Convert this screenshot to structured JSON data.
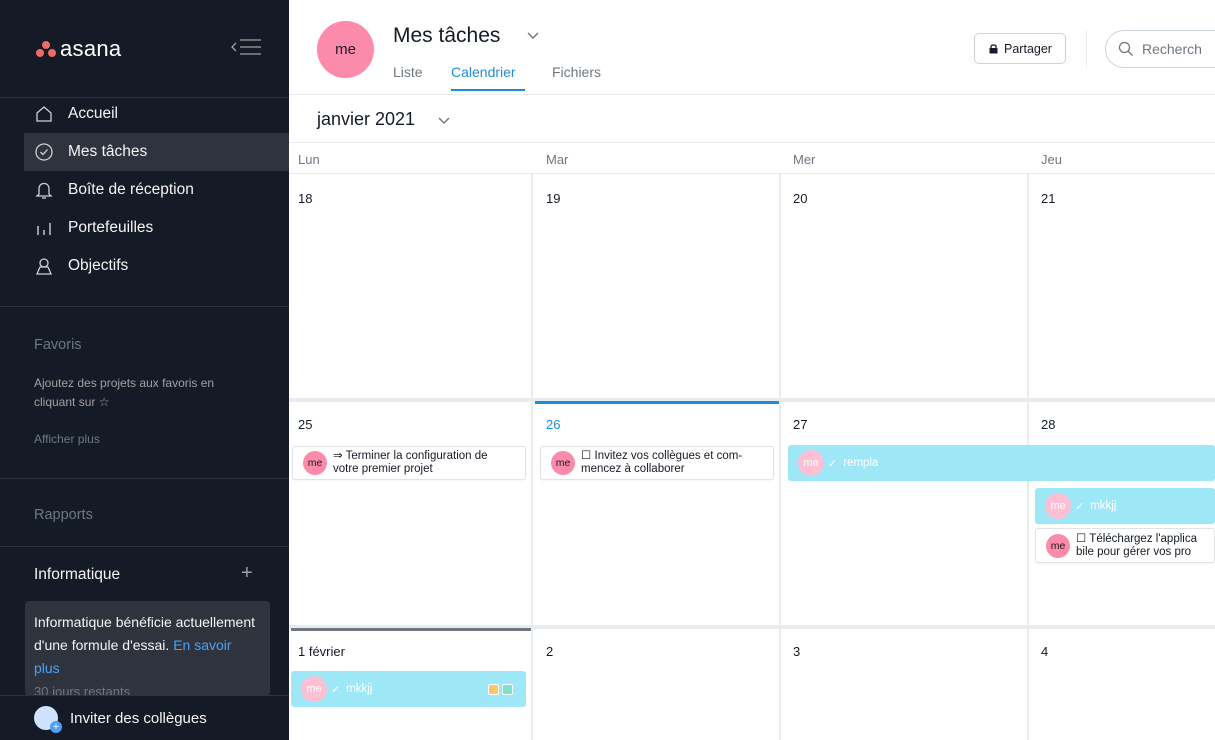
{
  "sidebar": {
    "logo_text": "asana",
    "nav": [
      {
        "label": "Accueil",
        "icon": "home-icon"
      },
      {
        "label": "Mes tâches",
        "icon": "check-circle-icon",
        "active": true
      },
      {
        "label": "Boîte de réception",
        "icon": "bell-icon"
      },
      {
        "label": "Portefeuilles",
        "icon": "bar-chart-icon"
      },
      {
        "label": "Objectifs",
        "icon": "person-icon"
      }
    ],
    "favorites_title": "Favoris",
    "favorites_hint": "Ajoutez des projets aux favoris en cliquant sur ☆",
    "show_more": "Afficher plus",
    "reports": "Rapports",
    "team_name": "Informatique",
    "team_add": "+",
    "trial_text": "Informatique bénéficie actuellement d'une formule d'essai.",
    "trial_link": "En savoir plus",
    "trial_days": "30 jours restants",
    "invite_label": "Inviter des collègues"
  },
  "header": {
    "avatar": "me",
    "title": "Mes tâches",
    "tabs": [
      "Liste",
      "Calendrier",
      "Fichiers"
    ],
    "active_tab": "Calendrier",
    "share_label": "Partager",
    "search_placeholder": "Recherch"
  },
  "calendar": {
    "month_label": "janvier 2021",
    "weekdays": [
      "Lun",
      "Mar",
      "Mer",
      "Jeu"
    ],
    "weeks": [
      [
        "18",
        "19",
        "20",
        "21"
      ],
      [
        "25",
        "26",
        "27",
        "28"
      ],
      [
        "1 février",
        "2",
        "3",
        "4"
      ]
    ],
    "today": "26",
    "tasks": {
      "t1": {
        "avatar": "me",
        "text": "⇒ Terminer la configuration de\nvotre premier projet"
      },
      "t2": {
        "avatar": "me",
        "text": "☐ Invitez vos collègues et com-\nmencez à collaborer"
      },
      "t3": {
        "avatar": "me",
        "text": "rempla",
        "check": "✓"
      },
      "t4": {
        "avatar": "me",
        "text": "mkkjj",
        "check": "✓"
      },
      "t5": {
        "avatar": "me",
        "text": "☐ Téléchargez l'applica\nbile pour gérer vos pro"
      },
      "t6": {
        "avatar": "me",
        "text": "mkkjj",
        "check": "✓"
      }
    },
    "tag_colors": [
      "#f8c96a",
      "#7fe0cf"
    ],
    "band_color": "#9ee7f7",
    "accent": "#1f8bd8"
  }
}
